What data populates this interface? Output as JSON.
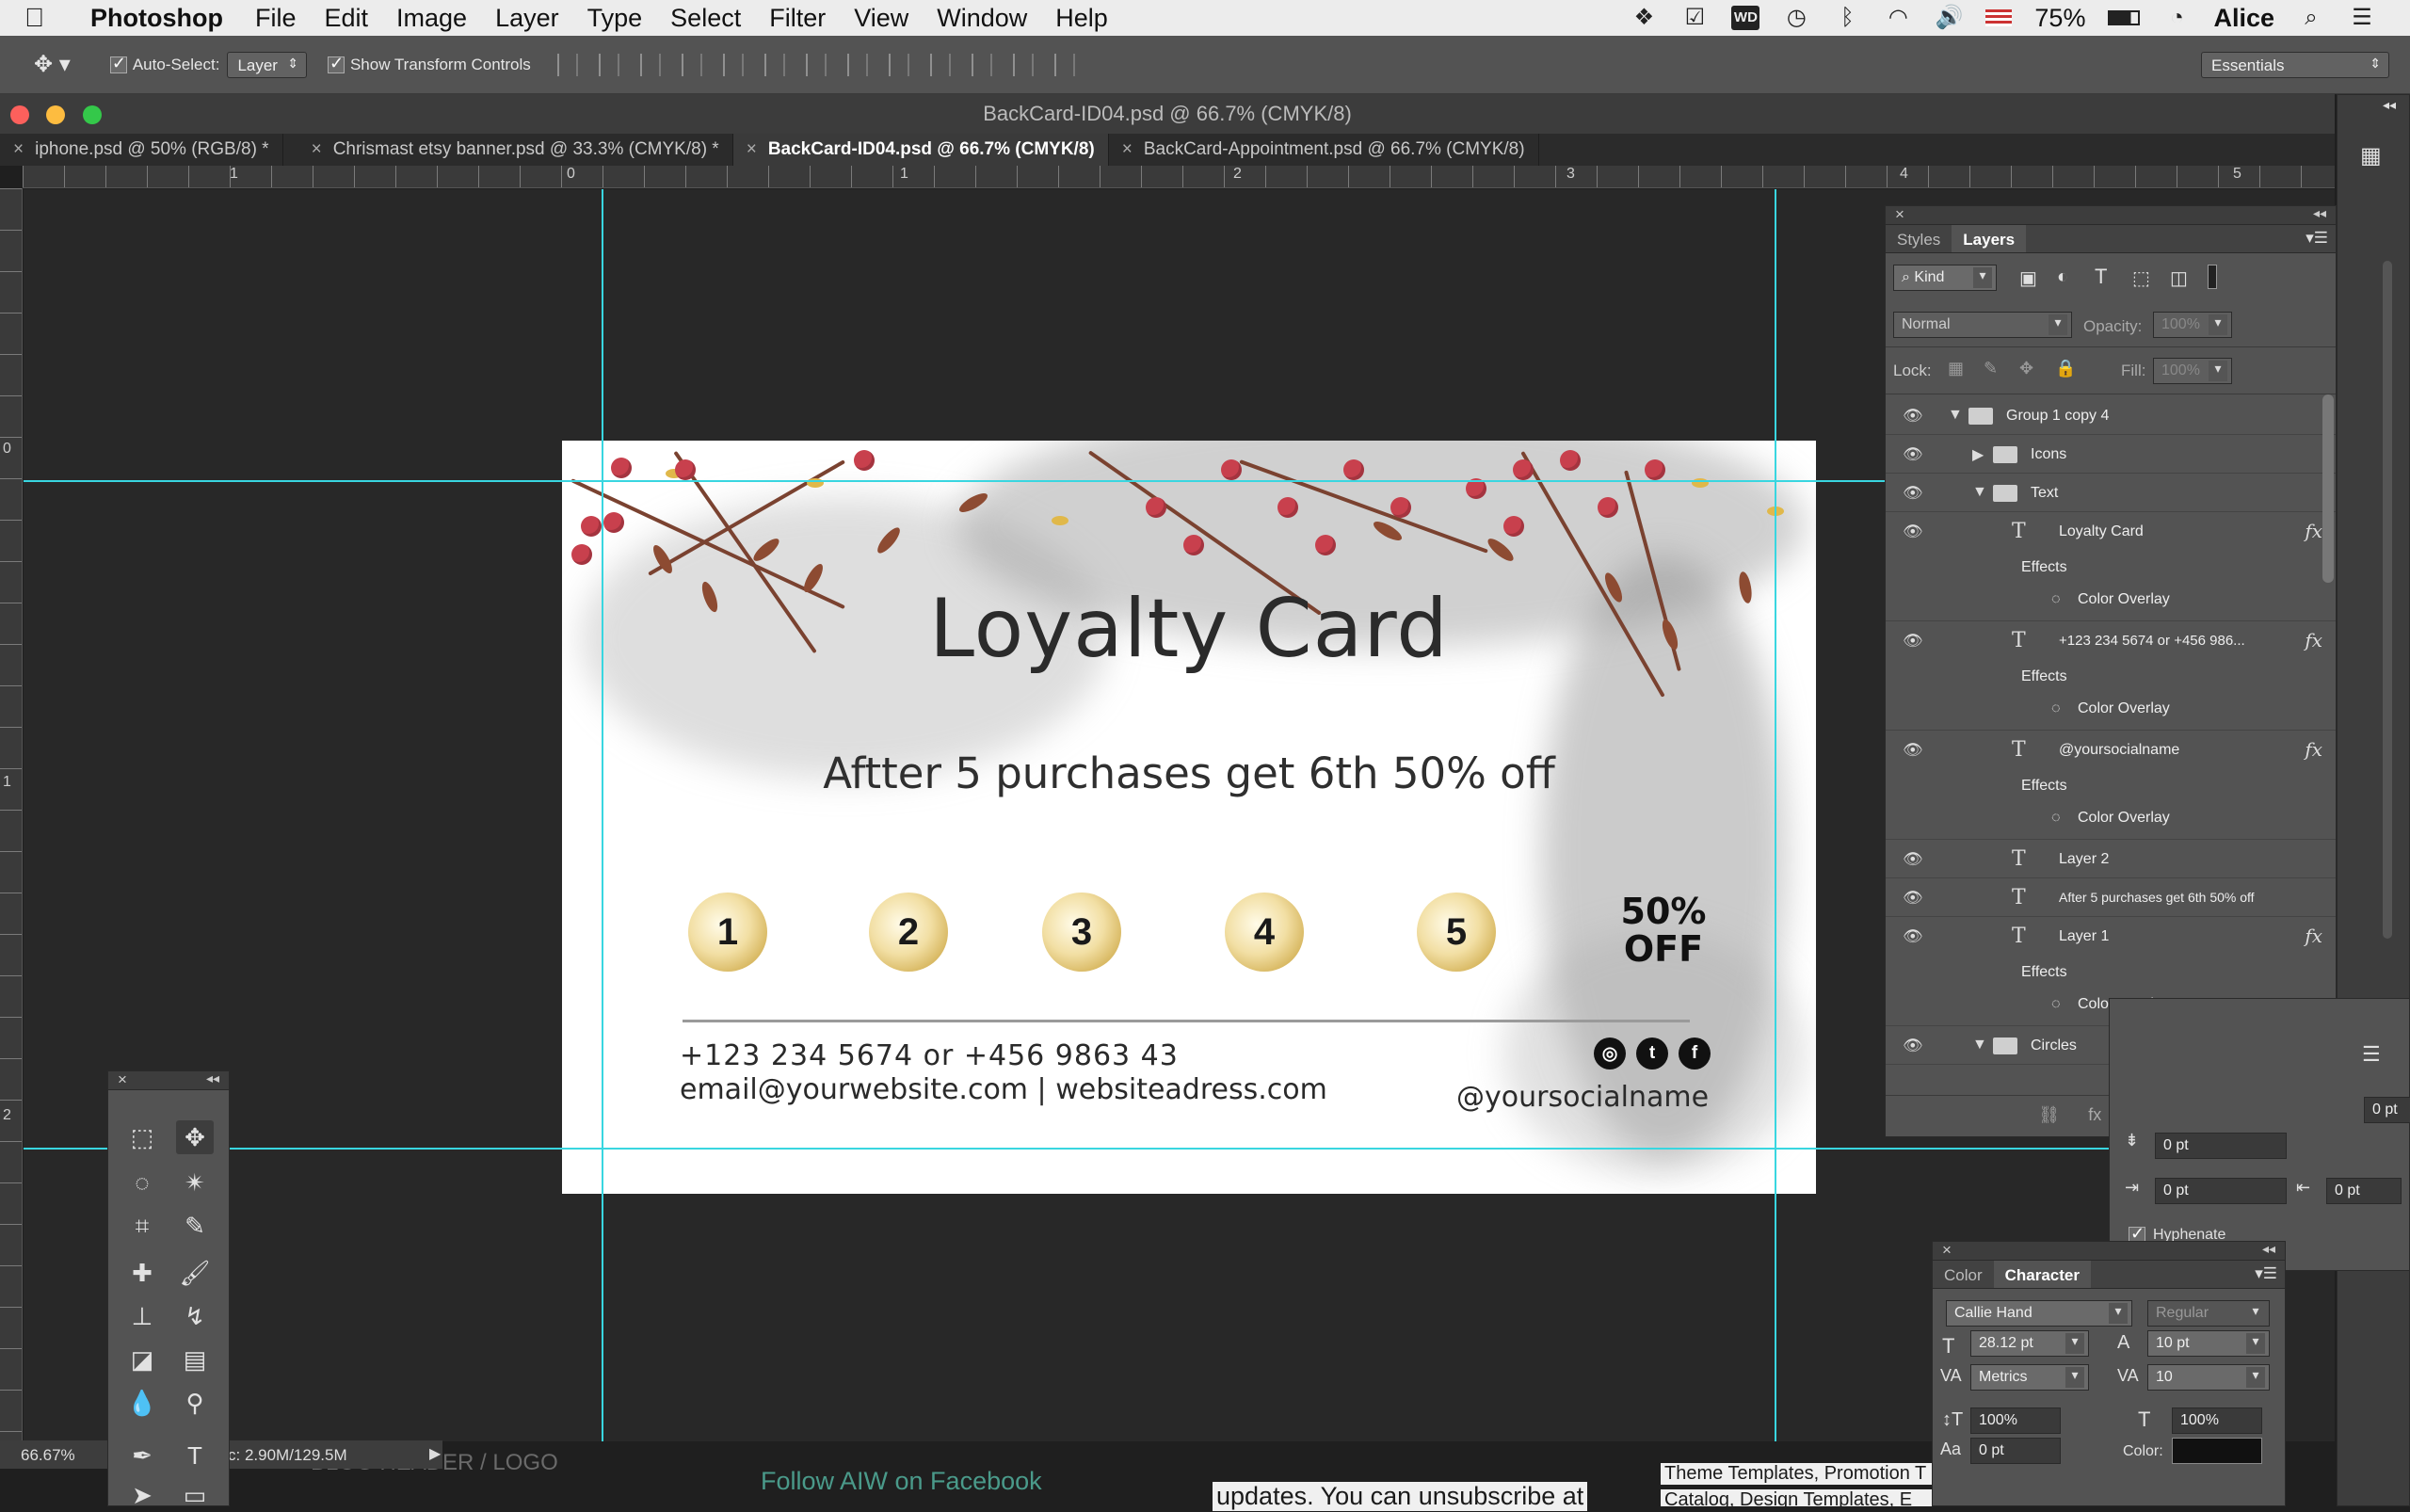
{
  "menubar": {
    "app_name": "Photoshop",
    "menus": [
      "File",
      "Edit",
      "Image",
      "Layer",
      "Type",
      "Select",
      "Filter",
      "View",
      "Window",
      "Help"
    ],
    "battery": "75%",
    "user": "Alice"
  },
  "options": {
    "auto_select_label": "Auto-Select:",
    "auto_select_value": "Layer",
    "show_transform_label": "Show Transform Controls",
    "workspace": "Essentials"
  },
  "window": {
    "title": "BackCard-ID04.psd @ 66.7% (CMYK/8)",
    "tabs": [
      {
        "label": "iphone.psd @ 50% (RGB/8) *"
      },
      {
        "label": "Chrismast etsy banner.psd @ 33.3% (CMYK/8) *"
      },
      {
        "label": "BackCard-ID04.psd @ 66.7% (CMYK/8)"
      },
      {
        "label": "BackCard-Appointment.psd @ 66.7% (CMYK/8)"
      }
    ]
  },
  "ruler": {
    "top_numbers": [
      "1",
      "0",
      "1",
      "2",
      "3",
      "4",
      "5"
    ],
    "left_numbers": [
      "0",
      "1",
      "2"
    ]
  },
  "card": {
    "title": "Loyalty Card",
    "subtitle": "Aftter 5 purchases get 6th 50% off",
    "circles": [
      "1",
      "2",
      "3",
      "4",
      "5"
    ],
    "offer_line1": "50%",
    "offer_line2": "OFF",
    "phone": "+123 234 5674 or +456 9863 43",
    "email": "email@yourwebsite.com | websiteadress.com",
    "social_handle": "@yoursocialname",
    "social_icons": [
      "instagram-icon",
      "twitter-icon",
      "facebook-icon"
    ]
  },
  "layers_panel": {
    "tabs": [
      "Styles",
      "Layers"
    ],
    "filter_kind": "Kind",
    "blend_mode": "Normal",
    "opacity_label": "Opacity:",
    "opacity_value": "100%",
    "lock_label": "Lock:",
    "fill_label": "Fill:",
    "fill_value": "100%",
    "effects_label": "Effects",
    "color_overlay_label": "Color Overlay",
    "layers": [
      {
        "name": "Group 1 copy 4"
      },
      {
        "name": "Icons"
      },
      {
        "name": "Text"
      },
      {
        "name": "Loyalty Card"
      },
      {
        "name": "+123 234 5674 or +456 986..."
      },
      {
        "name": "@yoursocialname"
      },
      {
        "name": "Layer 2"
      },
      {
        "name": "After 5 purchases get 6th 50% off"
      },
      {
        "name": "Layer 1"
      },
      {
        "name": "Circles"
      }
    ]
  },
  "paragraph_panel": {
    "values": [
      "0 pt",
      "0 pt",
      "0 pt",
      "0 pt"
    ],
    "hyphenate": "Hyphenate"
  },
  "character_panel": {
    "tabs": [
      "Color",
      "Character"
    ],
    "font_family": "Callie Hand",
    "font_style": "Regular",
    "font_size": "28.12 pt",
    "leading": "10 pt",
    "kerning": "Metrics",
    "tracking": "10",
    "vertical_scale": "100%",
    "horizontal_scale": "100%",
    "baseline_shift": "0 pt",
    "color_label": "Color:"
  },
  "status": {
    "zoom": "66.67%",
    "doc_size": "c: 2.90M/129.5M"
  },
  "background_page": {
    "blog_header": "BLOG HEADER / LOGO",
    "follow": "Follow AIW on Facebook",
    "updates": "updates. You can unsubscribe at",
    "themes": "Theme Templates, Promotion T",
    "catalog": "Catalog, Design Templates, E"
  },
  "colors": {
    "guide": "#39d6e0",
    "panel": "#535353",
    "canvas_bg": "#282828"
  }
}
